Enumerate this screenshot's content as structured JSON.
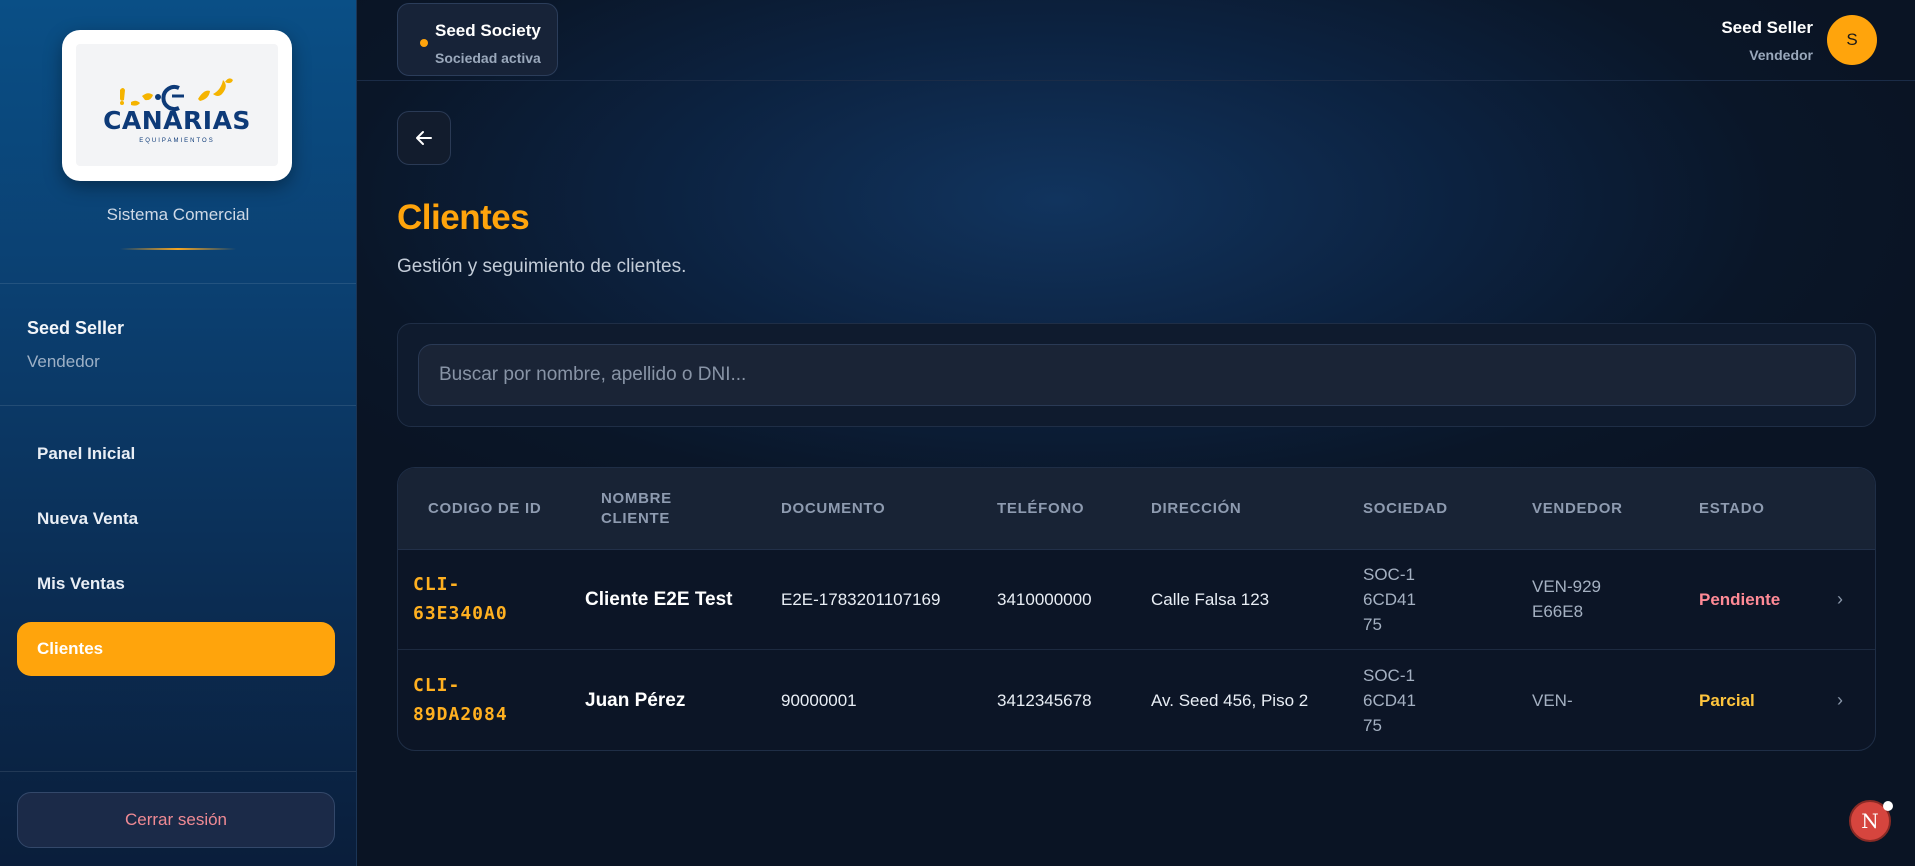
{
  "sidebar": {
    "logo": {
      "wordmark": "CANARIAS",
      "tagline": "EQUIPAMIENTOS"
    },
    "app_label": "Sistema Comercial",
    "user": {
      "name": "Seed Seller",
      "role": "Vendedor"
    },
    "nav": [
      {
        "label": "Panel Inicial",
        "active": false
      },
      {
        "label": "Nueva Venta",
        "active": false
      },
      {
        "label": "Mis Ventas",
        "active": false
      },
      {
        "label": "Clientes",
        "active": true
      }
    ],
    "logout_label": "Cerrar sesión"
  },
  "topbar": {
    "society": {
      "name": "Seed Society",
      "status": "Sociedad activa"
    },
    "user": {
      "name": "Seed Seller",
      "role": "Vendedor",
      "initial": "S"
    }
  },
  "page": {
    "title": "Clientes",
    "subtitle": "Gestión y seguimiento de clientes.",
    "search": {
      "placeholder": "Buscar por nombre, apellido o DNI...",
      "value": ""
    }
  },
  "table": {
    "headers": [
      "CODIGO DE ID",
      "NOMBRE CLIENTE",
      "DOCUMENTO",
      "TELÉFONO",
      "DIRECCIÓN",
      "SOCIEDAD",
      "VENDEDOR",
      "ESTADO"
    ],
    "rows": [
      {
        "code": "CLI-63E340A0",
        "name": "Cliente E2E Test",
        "document": "E2E-1783201107169",
        "phone": "3410000000",
        "address": "Calle Falsa 123",
        "society": "SOC-16CD4175",
        "seller": "VEN-929E66E8",
        "status": "Pendiente"
      },
      {
        "code": "CLI-89DA2084",
        "name": "Juan Pérez",
        "document": "90000001",
        "phone": "3412345678",
        "address": "Av. Seed 456, Piso 2",
        "society": "SOC-16CD4175",
        "seller": "VEN-",
        "status": "Parcial"
      }
    ]
  },
  "floating": {
    "badge_letter": "N"
  },
  "colors": {
    "accent": "#ffa40c",
    "pending": "#ff8a96",
    "partial": "#ffc53d",
    "logout": "#f08a94"
  },
  "icons": {
    "back": "arrow-left-icon",
    "row_open": "chevron-right-icon",
    "status_dot": "dot-icon"
  }
}
